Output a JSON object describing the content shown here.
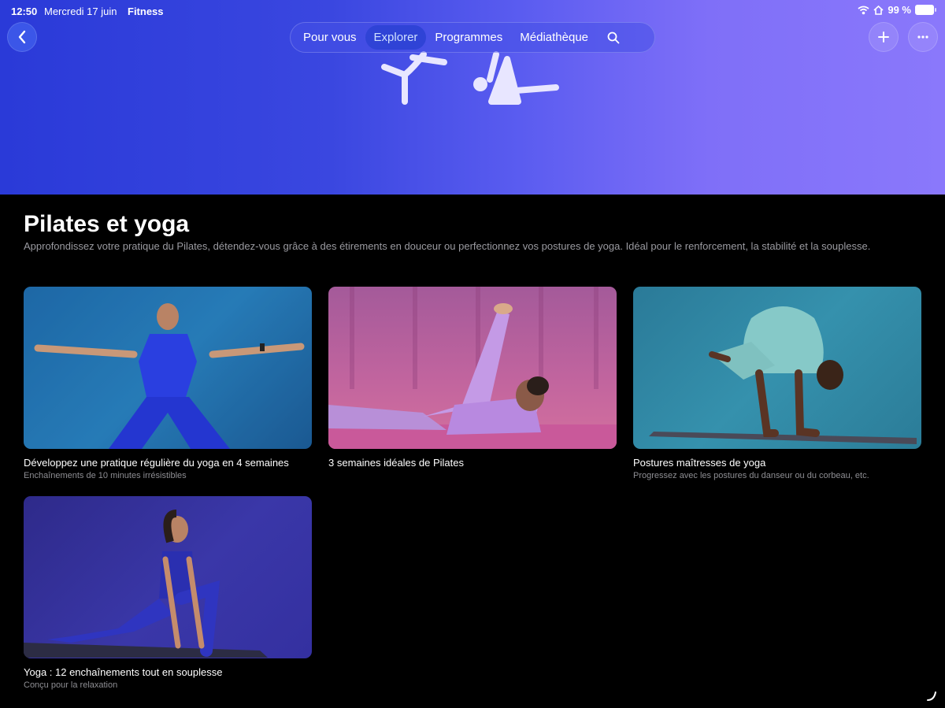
{
  "status": {
    "time": "12:50",
    "date": "Mercredi 17 juin",
    "app": "Fitness",
    "battery": "99 %"
  },
  "nav": {
    "tabs": [
      {
        "label": "Pour vous"
      },
      {
        "label": "Explorer"
      },
      {
        "label": "Programmes"
      },
      {
        "label": "Médiathèque"
      }
    ],
    "active_tab": "Explorer"
  },
  "page": {
    "title": "Pilates et yoga",
    "subtitle": "Approfondissez votre pratique du Pilates, détendez-vous grâce à des étirements en douceur ou perfectionnez vos postures de yoga. Idéal pour le renforcement, la stabilité et la souplesse."
  },
  "cards": [
    {
      "title": "Développez une pratique régulière du yoga en 4 semaines",
      "subtitle": "Enchaînements de 10 minutes irrésistibles"
    },
    {
      "title": "3 semaines idéales de Pilates",
      "subtitle": ""
    },
    {
      "title": "Postures maîtresses de yoga",
      "subtitle": "Progressez avec les postures du danseur ou du corbeau, etc."
    },
    {
      "title": "Yoga : 12 enchaînements tout en souplesse",
      "subtitle": "Conçu pour la relaxation"
    }
  ],
  "colors": {
    "hero_start": "#2a3ad8",
    "hero_end": "#8a78fb",
    "active_tab_bg": "#2f43d6",
    "background": "#000000"
  }
}
